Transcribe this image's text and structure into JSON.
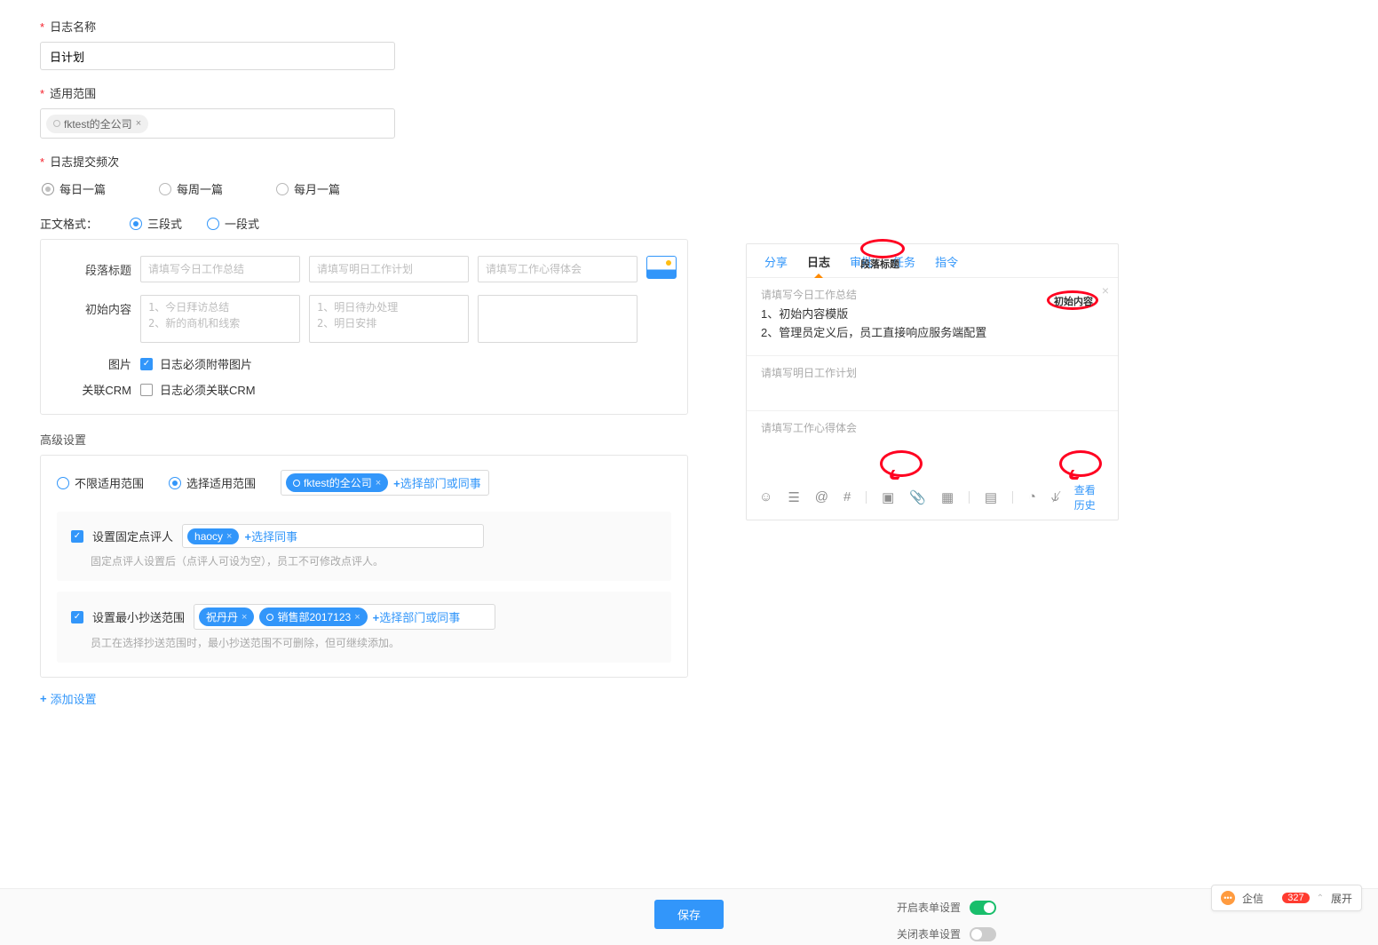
{
  "fields": {
    "log_name_label": "日志名称",
    "log_name_value": "日计划",
    "scope_label": "适用范围",
    "scope_tag": "fktest的全公司",
    "freq_label": "日志提交频次",
    "freq_opts": {
      "daily": "每日一篇",
      "weekly": "每周一篇",
      "monthly": "每月一篇"
    },
    "format_label": "正文格式：",
    "format_opts": {
      "three": "三段式",
      "one": "一段式"
    }
  },
  "seg": {
    "title_label": "段落标题",
    "init_label": "初始内容",
    "ph1": "请填写今日工作总结",
    "ph2": "请填写明日工作计划",
    "ph3": "请填写工作心得体会",
    "ta1": "1、今日拜访总结\n2、新的商机和线索",
    "ta2": "1、明日待办处理\n2、明日安排",
    "img_label": "图片",
    "img_text": "日志必须附带图片",
    "crm_label": "关联CRM",
    "crm_text": "日志必须关联CRM"
  },
  "adv": {
    "title": "高级设置",
    "opt_unlimited": "不限适用范围",
    "opt_select": "选择适用范围",
    "select_tag": "fktest的全公司",
    "select_link": "选择部门或同事",
    "rev_label": "设置固定点评人",
    "rev_tag": "haocy",
    "rev_link": "选择同事",
    "rev_note": "固定点评人设置后（点评人可设为空），员工不可修改点评人。",
    "cc_label": "设置最小抄送范围",
    "cc_tag1": "祝丹丹",
    "cc_tag2": "销售部2017123",
    "cc_link": "选择部门或同事",
    "cc_note": "员工在选择抄送范围时，最小抄送范围不可删除，但可继续添加。",
    "add_setting": "添加设置"
  },
  "footer": {
    "save": "保存",
    "open_form": "开启表单设置",
    "close_form": "关闭表单设置"
  },
  "preview": {
    "tabs": {
      "share": "分享",
      "log": "日志",
      "approve": "审批",
      "task": "任务",
      "order": "指令"
    },
    "annot_title": "段落标题",
    "annot_init": "初始内容",
    "s1_head": "请填写今日工作总结",
    "s1_l1": "1、初始内容模版",
    "s1_l2": "2、管理员定义后，员工直接响应服务端配置",
    "s2_head": "请填写明日工作计划",
    "s3_head": "请填写工作心得体会",
    "history": "查看历史"
  },
  "qixin": {
    "name": "企信",
    "count": "327",
    "expand": "展开"
  }
}
